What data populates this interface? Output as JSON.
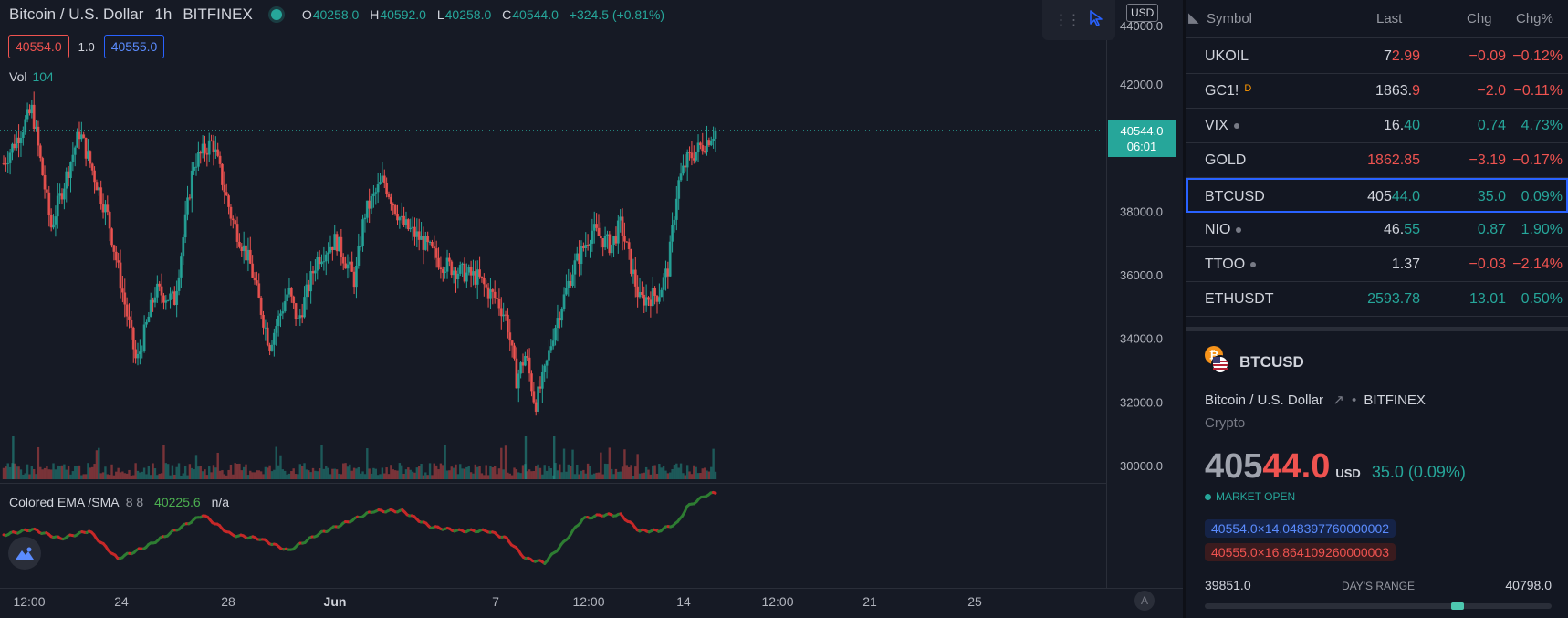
{
  "legend": {
    "symbol": "Bitcoin / U.S. Dollar",
    "interval": "1h",
    "exchange": "BITFINEX",
    "o_label": "O",
    "o": "40258.0",
    "h_label": "H",
    "h": "40592.0",
    "l_label": "L",
    "l": "40258.0",
    "c_label": "C",
    "c": "40544.0",
    "change": "+324.5 (+0.81%)"
  },
  "bidask": {
    "bid": "40554.0",
    "spread": "1.0",
    "ask": "40555.0"
  },
  "volume": {
    "label": "Vol",
    "value": "104"
  },
  "ema": {
    "label": "Colored EMA /SMA",
    "params": "8 8",
    "value": "40225.6",
    "na": "n/a"
  },
  "price_scale": {
    "currency": "USD",
    "top_partial": "44000.0",
    "current_price": "40544.0",
    "countdown": "06:01"
  },
  "chart_data": {
    "type": "candlestick",
    "symbol": "BTCUSD",
    "interval": "1h",
    "ylim": [
      29000,
      44000
    ],
    "yticks": [
      30000,
      32000,
      34000,
      36000,
      38000,
      40000,
      42000
    ],
    "ytick_labels": [
      "30000.0",
      "32000.0",
      "34000.0",
      "36000.0",
      "38000.0",
      "40000.0",
      "42000.0"
    ],
    "xticks": [
      "12:00",
      "24",
      "28",
      "Jun",
      "7",
      "12:00",
      "14",
      "12:00",
      "21",
      "25"
    ],
    "close_path": [
      [
        0,
        39500
      ],
      [
        3,
        41200
      ],
      [
        5,
        37500
      ],
      [
        8,
        40500
      ],
      [
        11,
        37800
      ],
      [
        14,
        33200
      ],
      [
        16,
        35500
      ],
      [
        18,
        35200
      ],
      [
        20,
        39500
      ],
      [
        22,
        40200
      ],
      [
        24,
        37800
      ],
      [
        26,
        36300
      ],
      [
        28,
        33800
      ],
      [
        30,
        35500
      ],
      [
        31,
        34500
      ],
      [
        33,
        36500
      ],
      [
        35,
        37100
      ],
      [
        37,
        35800
      ],
      [
        38,
        37900
      ],
      [
        40,
        39000
      ],
      [
        42,
        37600
      ],
      [
        44,
        37100
      ],
      [
        46,
        36400
      ],
      [
        48,
        36100
      ],
      [
        50,
        35900
      ],
      [
        51,
        35500
      ],
      [
        52,
        35200
      ],
      [
        53,
        34600
      ],
      [
        54,
        32700
      ],
      [
        55,
        33500
      ],
      [
        56,
        31900
      ],
      [
        57,
        32900
      ],
      [
        58,
        34300
      ],
      [
        60,
        36200
      ],
      [
        62,
        37400
      ],
      [
        64,
        36900
      ],
      [
        65,
        37600
      ],
      [
        66,
        36400
      ],
      [
        67,
        35200
      ],
      [
        69,
        35400
      ],
      [
        70,
        36200
      ],
      [
        71,
        38800
      ],
      [
        72,
        39600
      ],
      [
        74,
        40200
      ],
      [
        75,
        40544
      ]
    ],
    "volume_spikes": [
      [
        1,
        30000
      ],
      [
        55,
        30550
      ],
      [
        58,
        29950
      ]
    ],
    "ema_path": [
      [
        0,
        0.55
      ],
      [
        3,
        0.48
      ],
      [
        6,
        0.6
      ],
      [
        9,
        0.5
      ],
      [
        12,
        0.85
      ],
      [
        15,
        0.7
      ],
      [
        18,
        0.5
      ],
      [
        21,
        0.3
      ],
      [
        24,
        0.55
      ],
      [
        27,
        0.6
      ],
      [
        30,
        0.75
      ],
      [
        33,
        0.55
      ],
      [
        36,
        0.4
      ],
      [
        39,
        0.25
      ],
      [
        42,
        0.25
      ],
      [
        45,
        0.45
      ],
      [
        48,
        0.5
      ],
      [
        51,
        0.5
      ],
      [
        53,
        0.6
      ],
      [
        55,
        0.85
      ],
      [
        57,
        0.9
      ],
      [
        59,
        0.65
      ],
      [
        61,
        0.35
      ],
      [
        63,
        0.3
      ],
      [
        65,
        0.3
      ],
      [
        67,
        0.5
      ],
      [
        69,
        0.5
      ],
      [
        71,
        0.4
      ],
      [
        72,
        0.2
      ],
      [
        74,
        0.05
      ],
      [
        75,
        0.02
      ]
    ],
    "last": 40544.0,
    "ohlc": {
      "open": 40258.0,
      "high": 40592.0,
      "low": 40258.0,
      "close": 40544.0
    }
  },
  "watchlist": {
    "headers": {
      "symbol": "Symbol",
      "last": "Last",
      "chg": "Chg",
      "chgp": "Chg%"
    },
    "rows": [
      {
        "symbol": "UKOIL",
        "last_a": "7",
        "last_b": "2.99",
        "chg": "−0.09",
        "chgp": "−0.12%",
        "dir": "down"
      },
      {
        "symbol": "GC1!",
        "badge": "D",
        "last_a": "1863.",
        "last_b": "9",
        "chg": "−2.0",
        "chgp": "−0.11%",
        "dir": "down"
      },
      {
        "symbol": "VIX",
        "last_a": "16.",
        "last_b": "40",
        "chg": "0.74",
        "chgp": "4.73%",
        "dir": "up",
        "mdot": true
      },
      {
        "symbol": "GOLD",
        "last_a": "",
        "last_b": "1862.85",
        "chg": "−3.19",
        "chgp": "−0.17%",
        "dir": "down"
      },
      {
        "symbol": "BTCUSD",
        "last_a": "405",
        "last_b": "44.0",
        "chg": "35.0",
        "chgp": "0.09%",
        "dir": "up",
        "selected": true
      },
      {
        "symbol": "NIO",
        "last_a": "46.",
        "last_b": "55",
        "chg": "0.87",
        "chgp": "1.90%",
        "dir": "up",
        "mdot": true
      },
      {
        "symbol": "TTOO",
        "last_a": "1.37",
        "last_b": "",
        "chg": "−0.03",
        "chgp": "−2.14%",
        "dir": "down",
        "mdot": true
      },
      {
        "symbol": "ETHUSDT",
        "last_a": "",
        "last_b": "2593.78",
        "chg": "13.01",
        "chgp": "0.50%",
        "dir": "up"
      }
    ]
  },
  "details": {
    "symbol": "BTCUSD",
    "description": "Bitcoin / U.S. Dollar",
    "exchange": "BITFINEX",
    "category": "Crypto",
    "price_a": "405",
    "price_b": "44.0",
    "currency": "USD",
    "change": "35.0 (0.09%)",
    "status": "MARKET OPEN",
    "bid_tag": "40554.0×14.048397760000002",
    "ask_tag": "40555.0×16.864109260000003",
    "range_low": "39851.0",
    "range_label": "DAY'S RANGE",
    "range_high": "40798.0",
    "range_position": 0.73
  },
  "colors": {
    "up": "#26a69a",
    "down": "#ef5350",
    "accent": "#2962ff",
    "bg": "#131722"
  }
}
